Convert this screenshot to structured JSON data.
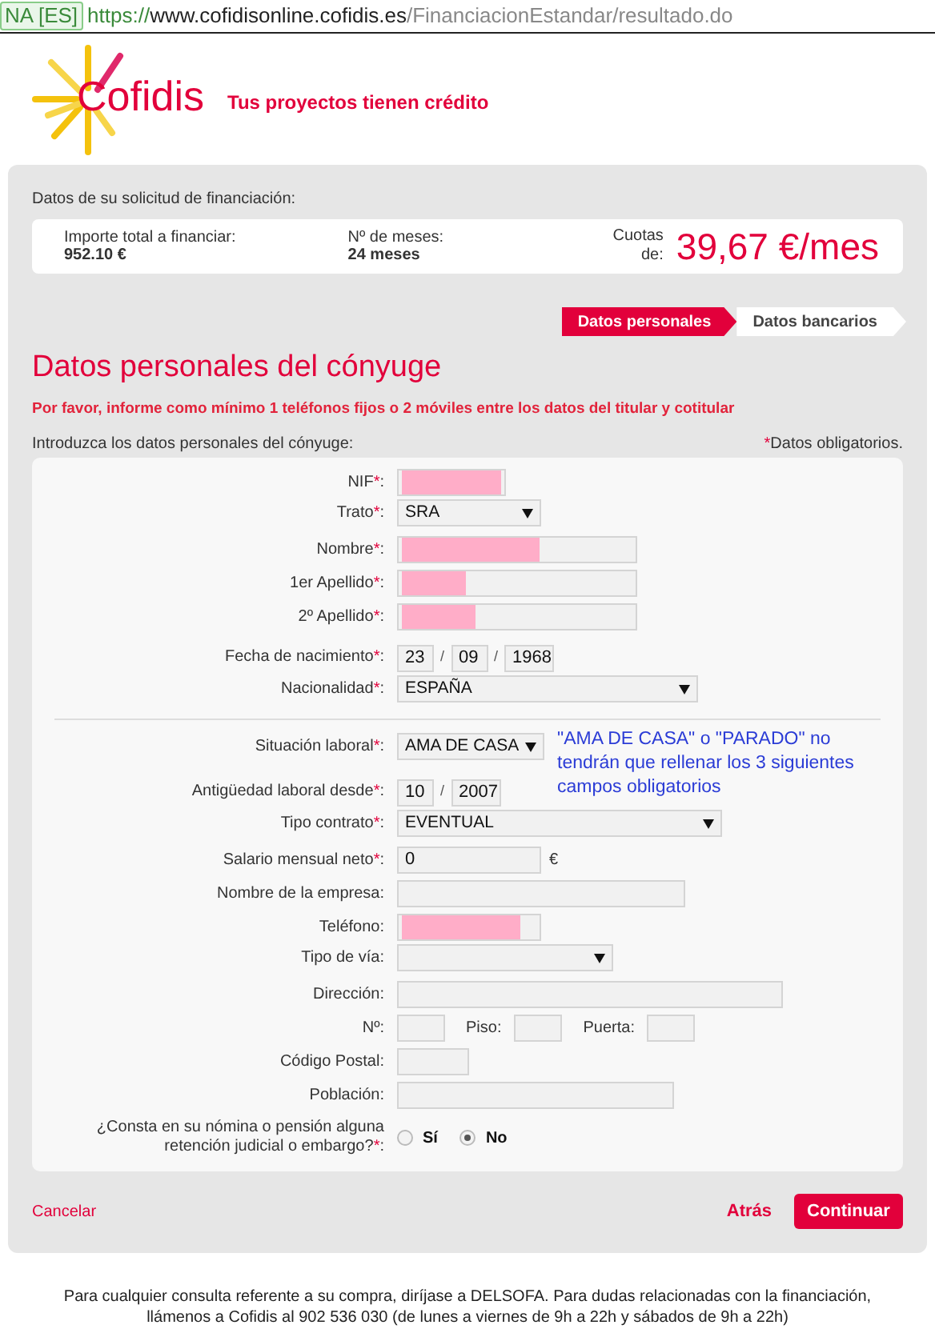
{
  "address_bar": {
    "badge": "NA [ES]",
    "url_scheme": "https://",
    "url_host": "www.cofidisonline.cofidis.es",
    "url_path": "/FinanciacionEstandar/resultado.do"
  },
  "header": {
    "logo_text": "Cofidis",
    "tagline": "Tus proyectos tienen crédito"
  },
  "summary": {
    "heading": "Datos de su solicitud de financiación:",
    "items": [
      {
        "label": "Importe total a financiar:",
        "value": "952.10 €"
      },
      {
        "label": "Nº de meses:",
        "value": "24 meses"
      }
    ],
    "quota_label": "Cuotas de:",
    "quota_value": "39,67 €/mes"
  },
  "steps": [
    {
      "label": "Datos personales",
      "selected": true
    },
    {
      "label": "Datos bancarios",
      "selected": false
    }
  ],
  "title": "Datos personales del cónyuge",
  "notice": "Por favor, informe como mínimo 1 teléfonos fijos o 2 móviles entre los datos del titular y cotitular",
  "intro": "Introduzca los datos personales del cónyuge:",
  "required_note": {
    "mark": "*",
    "text": "Datos obligatorios."
  },
  "fields": [
    {
      "kind": "input",
      "label": "NIF",
      "asterisk": "*",
      "tail": ":",
      "redacted": true
    },
    {
      "kind": "select",
      "label": "Trato",
      "asterisk": "*",
      "tail": ":",
      "value": "SRA"
    },
    {
      "kind": "input",
      "label": "Nombre",
      "asterisk": "*",
      "tail": ":",
      "redacted": true
    },
    {
      "kind": "input",
      "label": "1er Apellido",
      "asterisk": "*",
      "tail": ":",
      "redacted": true
    },
    {
      "kind": "input",
      "label": "2º Apellido",
      "asterisk": "*",
      "tail": ":",
      "redacted": true
    },
    {
      "kind": "parts",
      "label": "Fecha de nacimiento",
      "asterisk": "*",
      "tail": ":",
      "separator": "/",
      "parts": [
        "23",
        "09",
        "1968"
      ]
    },
    {
      "kind": "select",
      "label": "Nacionalidad",
      "asterisk": "*",
      "tail": ":",
      "value": "ESPAÑA"
    },
    {
      "kind": "divider"
    },
    {
      "kind": "select",
      "label": "Situación laboral",
      "asterisk": "*",
      "tail": ":",
      "value": "AMA DE CASA",
      "annotation": "\"AMA DE CASA\" o \"PARADO\" no tendrán que rellenar los 3 siguientes campos obligatorios"
    },
    {
      "kind": "parts",
      "label": "Antigüedad laboral desde",
      "asterisk": "*",
      "tail": ":",
      "separator": "/",
      "parts": [
        "10",
        "2007"
      ]
    },
    {
      "kind": "select",
      "label": "Tipo contrato",
      "asterisk": "*",
      "tail": ":",
      "value": "EVENTUAL"
    },
    {
      "kind": "input",
      "label": "Salario mensual neto",
      "asterisk": "*",
      "tail": ":",
      "value": "0",
      "unit": "€"
    },
    {
      "kind": "input",
      "label": "Nombre de la empresa:"
    },
    {
      "kind": "input",
      "label": "Teléfono:",
      "redacted": true
    },
    {
      "kind": "select",
      "label": "Tipo de vía:"
    },
    {
      "kind": "input",
      "label": "Dirección:"
    },
    {
      "kind": "address",
      "label": "Nº:",
      "extra": [
        {
          "label": "Piso:"
        },
        {
          "label": "Puerta:"
        }
      ]
    },
    {
      "kind": "input",
      "label": "Código Postal:"
    },
    {
      "kind": "input",
      "label": "Población:"
    },
    {
      "kind": "radio",
      "label": "¿Consta en su nómina o pensión alguna retención judicial o embargo?",
      "asterisk": "*",
      "tail": ":",
      "options": [
        {
          "label": "Sí",
          "selected": false
        },
        {
          "label": "No",
          "selected": true
        }
      ]
    }
  ],
  "actions": {
    "cancel": "Cancelar",
    "back": "Atrás",
    "continue": "Continuar"
  },
  "footer": "Para cualquier consulta referente a su compra, diríjase a DELSOFA. Para dudas relacionadas con la financiación, llámenos a Cofidis al 902 536 030 (de lunes a viernes de 9h a 22h y sábados de 9h a 22h)"
}
